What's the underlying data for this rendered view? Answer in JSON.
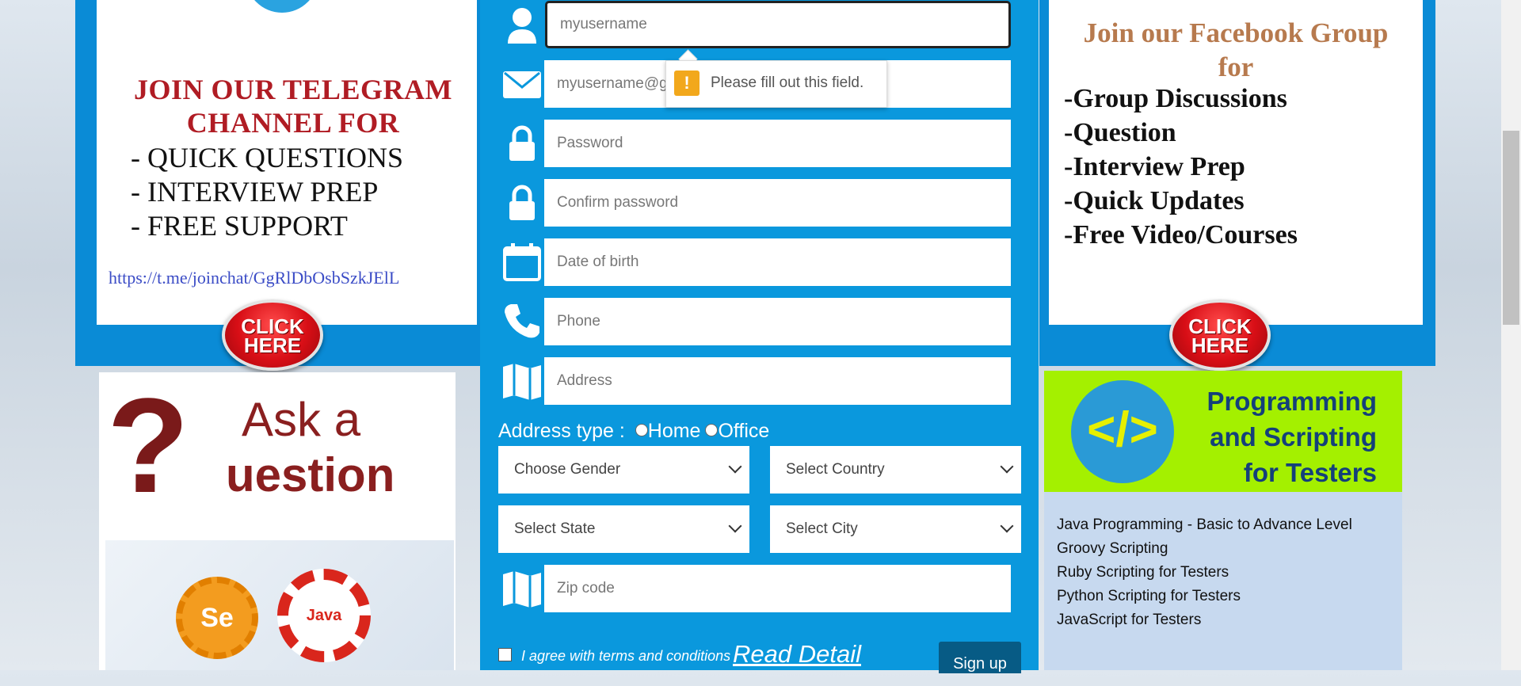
{
  "telegram": {
    "title_line1": "JOIN OUR TELEGRAM",
    "title_line2": "CHANNEL  FOR",
    "lines": [
      "- QUICK QUESTIONS",
      "- INTERVIEW PREP",
      "- FREE SUPPORT"
    ],
    "link": "https://t.me/joinchat/GgRlDbOsbSzkJElL",
    "click_line1": "CLICK",
    "click_line2": "HERE"
  },
  "facebook": {
    "title_line1": "Join our Facebook Group",
    "title_line2": "for",
    "lines": [
      "-Group Discussions",
      "-Question",
      "-Interview Prep",
      "-Quick Updates",
      "-Free Video/Courses"
    ],
    "click_line1": "CLICK",
    "click_line2": "HERE"
  },
  "ask": {
    "q": "?",
    "text1": "Ask a",
    "text2": "uestion",
    "se": "Se",
    "java": "Java"
  },
  "programming": {
    "icon": "</>",
    "title_line1": "Programming",
    "title_line2": "and Scripting",
    "title_line3": "for Testers",
    "items": [
      "Java Programming - Basic to Advance Level",
      "Groovy Scripting",
      "Ruby Scripting for Testers",
      "Python Scripting for Testers",
      "JavaScript for Testers"
    ]
  },
  "form": {
    "username_placeholder": "myusername",
    "email_placeholder": "myusername@gmail.com",
    "password_placeholder": "Password",
    "confirm_placeholder": "Confirm password",
    "dob_placeholder": "Date of birth",
    "phone_placeholder": "Phone",
    "address_placeholder": "Address",
    "zip_placeholder": "Zip code",
    "tooltip": "Please fill out this field.",
    "address_type_label": "Address type :",
    "home": "Home",
    "office": "Office",
    "gender": "Choose Gender",
    "country": "Select Country",
    "state": "Select State",
    "city": "Select City",
    "agree": "I agree with terms and conditions",
    "read_detail": "Read Detail",
    "signup": "Sign up"
  },
  "colors": {
    "form_blue": "#0a98dd",
    "icon_blue": "#14a0e6"
  }
}
